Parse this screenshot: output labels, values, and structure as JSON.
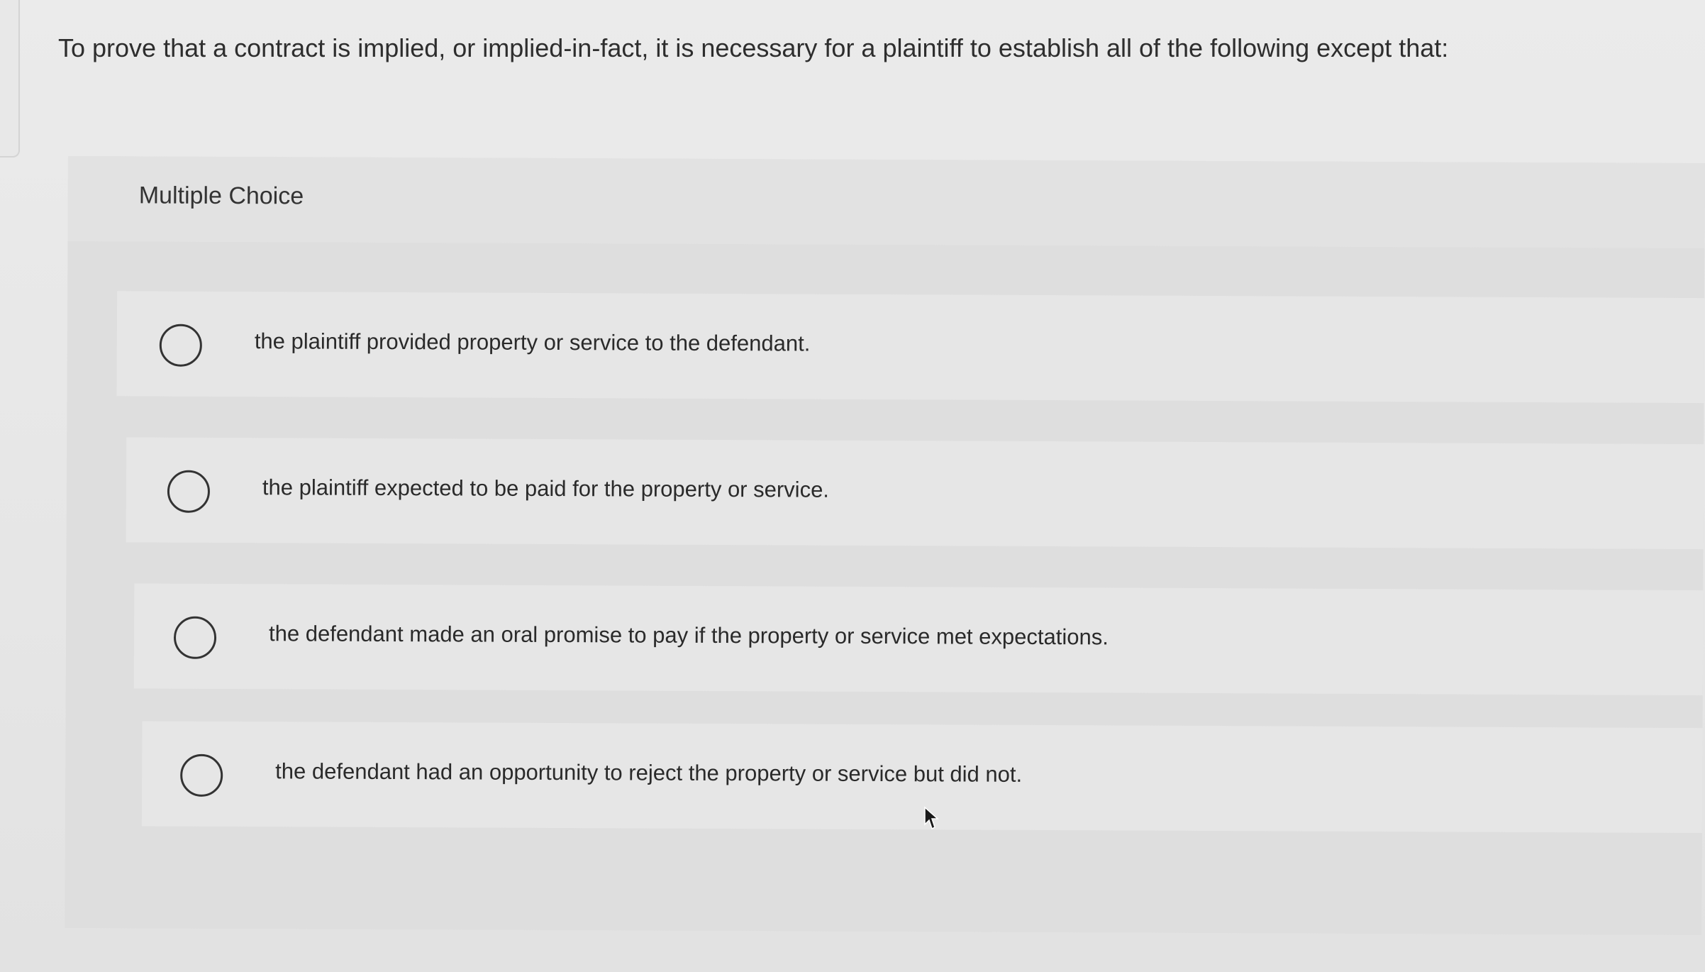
{
  "question": {
    "text": "To prove that a contract is implied, or implied-in-fact, it is necessary for a plaintiff to establish all of the following except that:"
  },
  "multiple_choice": {
    "label": "Multiple Choice",
    "options": [
      {
        "text": "the plaintiff provided property or service to the defendant.",
        "selected": false
      },
      {
        "text": "the plaintiff expected to be paid for the property or service.",
        "selected": false
      },
      {
        "text": "the defendant made an oral promise to pay if the property or service met expectations.",
        "selected": false
      },
      {
        "text": "the defendant had an opportunity to reject the property or service but did not.",
        "selected": false
      }
    ]
  },
  "colors": {
    "background": "#e9e9e9",
    "panel": "#dedede",
    "option_row": "#e6e6e6",
    "text": "#2b2b2b",
    "radio_border": "#333333"
  },
  "icons": {
    "radio": "radio-circle-icon",
    "cursor": "mouse-pointer-icon"
  }
}
